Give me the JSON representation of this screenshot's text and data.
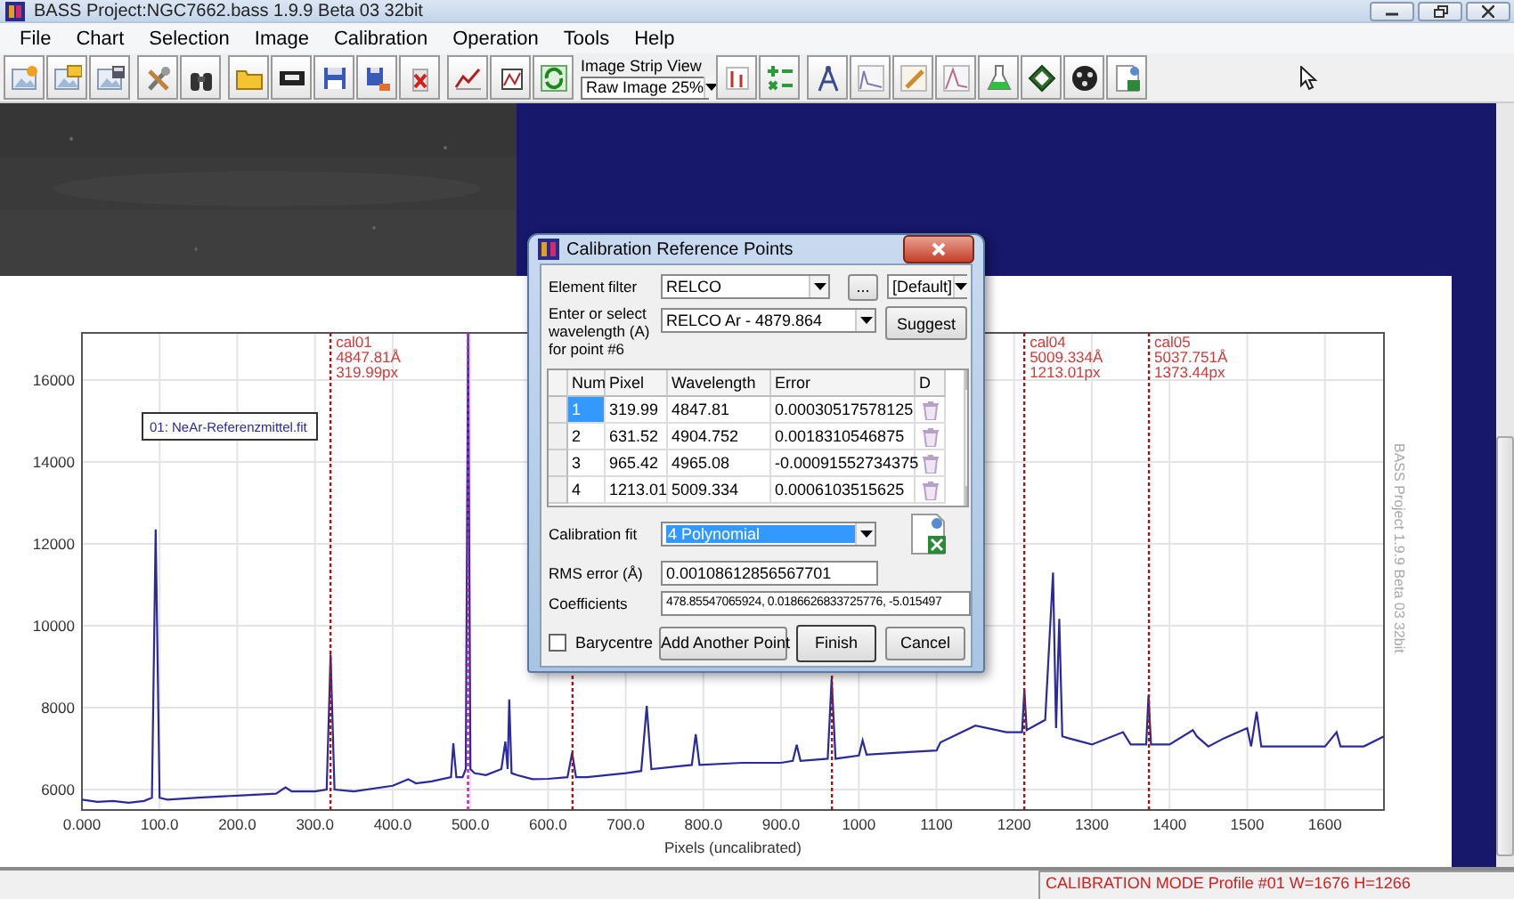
{
  "window": {
    "title": "BASS Project:NGC7662.bass  1.9.9 Beta 03 32bit"
  },
  "menu": [
    "File",
    "Chart",
    "Selection",
    "Image",
    "Calibration",
    "Operation",
    "Tools",
    "Help"
  ],
  "toolbar": {
    "strip_label": "Image Strip View",
    "strip_value": "Raw Image 25%"
  },
  "chart": {
    "watermark": "BASS Project 1.9.9 Beta 03 32bit",
    "chart_data": {
      "type": "line",
      "grid": true,
      "xlabel": "Pixels (uncalibrated)",
      "xlim": [
        0,
        1676
      ],
      "ylim": [
        5500,
        17150
      ],
      "xticks": [
        {
          "value": 0,
          "label": "0.000"
        },
        {
          "value": 100,
          "label": "100.0"
        },
        {
          "value": 200,
          "label": "200.0"
        },
        {
          "value": 300,
          "label": "300.0"
        },
        {
          "value": 400,
          "label": "400.0"
        },
        {
          "value": 500,
          "label": "500.0"
        },
        {
          "value": 600,
          "label": "600.0"
        },
        {
          "value": 700,
          "label": "700.0"
        },
        {
          "value": 800,
          "label": "800.0"
        },
        {
          "value": 900,
          "label": "900.0"
        },
        {
          "value": 1000,
          "label": "1000"
        },
        {
          "value": 1100,
          "label": "1100"
        },
        {
          "value": 1200,
          "label": "1200"
        },
        {
          "value": 1300,
          "label": "1300"
        },
        {
          "value": 1400,
          "label": "1400"
        },
        {
          "value": 1500,
          "label": "1500"
        },
        {
          "value": 1600,
          "label": "1600"
        }
      ],
      "yticks": [
        6000,
        8000,
        10000,
        12000,
        14000,
        16000
      ],
      "x": [
        0,
        20,
        40,
        60,
        80,
        90,
        95,
        100,
        110,
        150,
        200,
        250,
        262,
        270,
        300,
        315,
        320,
        325,
        350,
        400,
        420,
        430,
        450,
        475,
        478,
        482,
        490,
        494,
        497,
        500,
        505,
        520,
        540,
        545,
        548,
        550,
        553,
        560,
        580,
        600,
        625,
        631,
        636,
        650,
        700,
        720,
        727,
        733,
        760,
        785,
        790,
        795,
        850,
        900,
        915,
        920,
        925,
        960,
        965,
        970,
        1000,
        1005,
        1010,
        1050,
        1100,
        1105,
        1150,
        1190,
        1210,
        1213,
        1216,
        1240,
        1250,
        1254,
        1258,
        1262,
        1270,
        1300,
        1340,
        1350,
        1370,
        1373,
        1376,
        1400,
        1430,
        1435,
        1450,
        1470,
        1500,
        1505,
        1512,
        1518,
        1550,
        1600,
        1615,
        1620,
        1650,
        1676
      ],
      "series": [
        {
          "name": "01: NeAr-Referenzmittel.fit",
          "color": "#2a2a9a",
          "values": [
            5750,
            5700,
            5720,
            5680,
            5720,
            5800,
            12350,
            5800,
            5750,
            5800,
            5850,
            5900,
            6050,
            5950,
            5950,
            6000,
            9300,
            6000,
            5950,
            6090,
            6250,
            6150,
            6200,
            6300,
            7130,
            6300,
            6300,
            6500,
            17150,
            6500,
            6400,
            6350,
            6500,
            7170,
            6500,
            8200,
            6400,
            6350,
            6250,
            6260,
            6300,
            6900,
            6300,
            6300,
            6400,
            6450,
            8040,
            6500,
            6550,
            6600,
            7350,
            6600,
            6650,
            6650,
            6700,
            7090,
            6700,
            6750,
            8700,
            6750,
            6830,
            7200,
            6850,
            6900,
            6950,
            7150,
            7560,
            7400,
            7400,
            8430,
            7450,
            7700,
            11300,
            7500,
            10170,
            7300,
            7250,
            7100,
            7400,
            7100,
            7100,
            8300,
            7100,
            7100,
            7450,
            7300,
            7050,
            7250,
            7500,
            7050,
            7900,
            7050,
            7050,
            7050,
            7400,
            7050,
            7050,
            7300
          ]
        }
      ],
      "ref_lines": [
        {
          "axis": "x",
          "value": 319.99,
          "color": "#a01818",
          "label": "cal01\n4847.81Å\n319.99px"
        },
        {
          "axis": "x",
          "value": 497,
          "color": "#c020c0"
        },
        {
          "axis": "x",
          "value": 631.52,
          "color": "#a01818"
        },
        {
          "axis": "x",
          "value": 965.42,
          "color": "#a01818"
        },
        {
          "axis": "x",
          "value": 1213.01,
          "color": "#a01818",
          "label": "cal04\n5009.334Å\n1213.01px"
        },
        {
          "axis": "x",
          "value": 1373.44,
          "color": "#a01818",
          "label": "cal05\n5037.751Å\n1373.44px"
        }
      ]
    }
  },
  "dialog": {
    "title": "Calibration Reference Points",
    "element_filter": {
      "label": "Element filter",
      "value": "RELCO"
    },
    "browse_button": "...",
    "preset": {
      "value": "[Default]"
    },
    "wavelength": {
      "label": "Enter or select wavelength (A) for point #6",
      "value": "RELCO Ar - 4879.864"
    },
    "suggest_button": "Suggest",
    "table": {
      "columns": [
        "Num",
        "Pixel",
        "Wavelength",
        "Error",
        "D"
      ],
      "rows": [
        {
          "num": "1",
          "pixel": "319.99",
          "wavelength": "4847.81",
          "error": "0.00030517578125",
          "selected": true
        },
        {
          "num": "2",
          "pixel": "631.52",
          "wavelength": "4904.752",
          "error": "0.0018310546875",
          "selected": false
        },
        {
          "num": "3",
          "pixel": "965.42",
          "wavelength": "4965.08",
          "error": "-0.00091552734375",
          "selected": false
        },
        {
          "num": "4",
          "pixel": "1213.01",
          "wavelength": "5009.334",
          "error": "0.0006103515625",
          "selected": false
        }
      ]
    },
    "fit": {
      "label": "Calibration fit",
      "value": "4 Polynomial",
      "focused": true
    },
    "rms": {
      "label": "RMS error (Å)",
      "value": "0.00108612856567701"
    },
    "coefficients": {
      "label": "Coefficients",
      "value": "478.85547065924, 0.0186626833725776, -5.015497"
    },
    "barycentre": {
      "label": "Barycentre",
      "checked": false
    },
    "buttons": [
      {
        "label": "Add Another Point",
        "default": false
      },
      {
        "label": "Finish",
        "default": true
      },
      {
        "label": "Cancel",
        "default": false
      }
    ]
  },
  "status_bar": "CALIBRATION MODE Profile #01 W=1676 H=1266"
}
